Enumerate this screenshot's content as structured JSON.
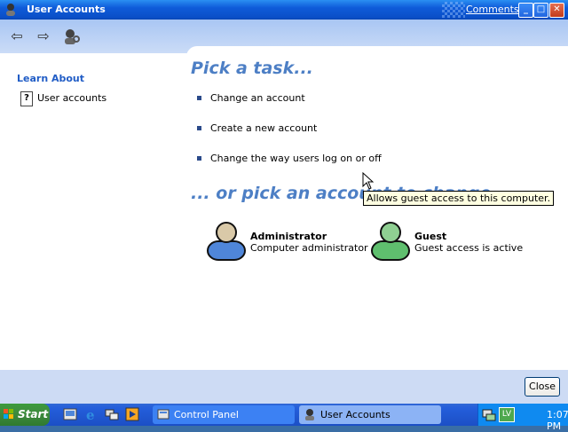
{
  "window": {
    "title": "User Accounts",
    "comments_link": "Comments?",
    "buttons": {
      "minimize": "_",
      "maximize": "□",
      "close": "✕"
    }
  },
  "sidebar": {
    "learn_about_title": "Learn About",
    "links": [
      {
        "label": "User accounts",
        "icon": "help-topic-icon"
      }
    ]
  },
  "main": {
    "pick_task_heading": "Pick a task...",
    "tasks": [
      {
        "label": "Change an account"
      },
      {
        "label": "Create a new account"
      },
      {
        "label": "Change the way users log on or off"
      }
    ],
    "pick_account_heading": "... or pick an account to change",
    "accounts": [
      {
        "name": "Administrator",
        "description": "Computer administrator",
        "avatar_color": "#4f86d9"
      },
      {
        "name": "Guest",
        "description": "Guest access is active",
        "avatar_color": "#5fbf6e"
      }
    ]
  },
  "tooltip": {
    "text": "Allows guest access to this computer."
  },
  "footer": {
    "close_button": "Close"
  },
  "taskbar": {
    "start_label": "Start",
    "windows": [
      {
        "label": "Control Panel",
        "active": false
      },
      {
        "label": "User Accounts",
        "active": true
      }
    ],
    "tray": {
      "language": "LV",
      "time": "1:07 PM"
    }
  },
  "colors": {
    "title_bar": "#0a4fc7",
    "heading": "#4d7fc5",
    "taskbar": "#245edb",
    "start": "#3f8c3f"
  }
}
